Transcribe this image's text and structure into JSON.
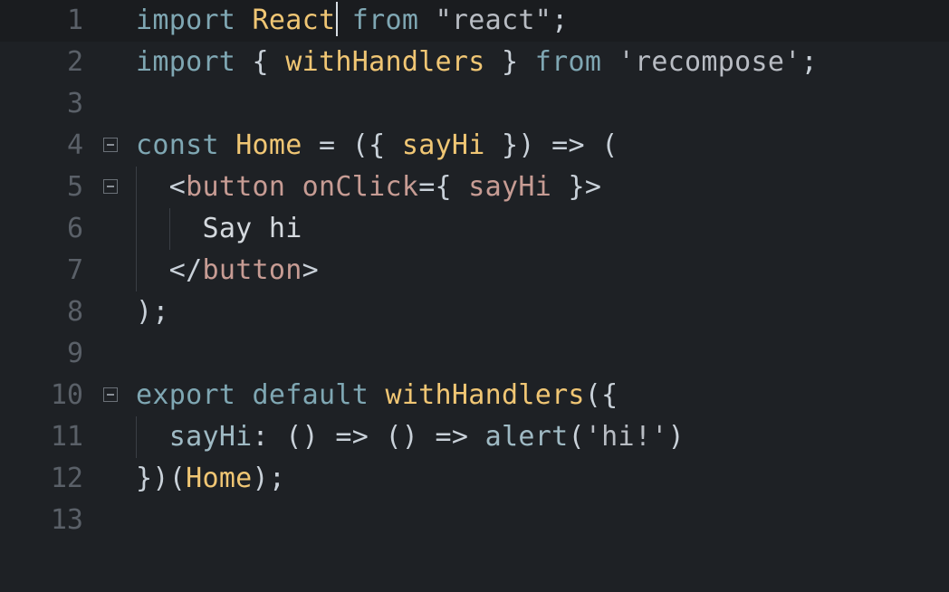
{
  "editor": {
    "line_numbers": [
      "1",
      "2",
      "3",
      "4",
      "5",
      "6",
      "7",
      "8",
      "9",
      "10",
      "11",
      "12",
      "13"
    ],
    "lines": {
      "l1": {
        "kw_import": "import",
        "id_react": "React",
        "kw_from": "from",
        "str_react": "\"react\"",
        "semi": ";"
      },
      "l2": {
        "kw_import": "import",
        "brace_open": "{",
        "id_with": "withHandlers",
        "brace_close": "}",
        "kw_from": "from",
        "str_recompose": "'recompose'",
        "semi": ";"
      },
      "l4": {
        "kw_const": "const",
        "id_home": "Home",
        "rest_1": "= ({",
        "id_sayhi": "sayHi",
        "rest_2": "}) => ("
      },
      "l5": {
        "lt": "<",
        "tag_button": "button",
        "attr_onclick": "onClick",
        "eq_brace": "={",
        "attr_sayhi": "sayHi",
        "close": "}>"
      },
      "l6": {
        "text": "Say hi"
      },
      "l7": {
        "lt_slash": "</",
        "tag_button": "button",
        "gt": ">"
      },
      "l8": {
        "text": ");"
      },
      "l10": {
        "kw_export": "export",
        "kw_default": "default",
        "id_with": "withHandlers",
        "paren": "({"
      },
      "l11": {
        "prop": "sayHi",
        "rest_1": ": () => () =>",
        "fn_alert": "alert",
        "paren_open": "(",
        "str_hi": "'hi!'",
        "paren_close": ")"
      },
      "l12": {
        "close": "})(",
        "id_home": "Home",
        "end": ");"
      }
    }
  }
}
